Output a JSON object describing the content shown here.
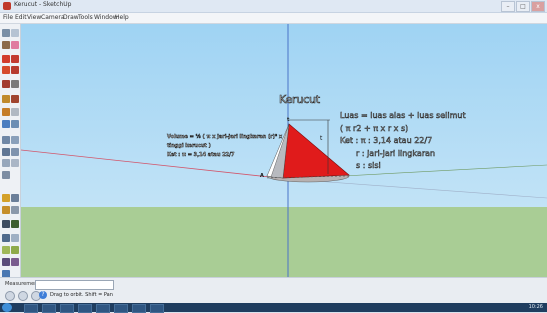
{
  "window": {
    "title": "Kerucut - SketchUp",
    "controls": [
      "–",
      "□",
      "x"
    ]
  },
  "menu": [
    "File",
    "Edit",
    "View",
    "Camera",
    "Draw",
    "Tools",
    "Window",
    "Help"
  ],
  "model": {
    "title": "Kerucut",
    "right_formula": [
      "Luas = luas alas + luas selimut",
      "( π r2 + π x r x s)",
      "Ket : π : 3,14 atau 22/7",
      "r : jari-jari lingkaran",
      "s : sisi"
    ],
    "left_formula": [
      "Volume = ⅓ ( π x jari-jari lingkaran (r)² x",
      "tinggi kerucut )",
      "Ket : π = 3,14 atau 22/7"
    ],
    "apex_label": "t",
    "dim_label": "t",
    "base_label": "A"
  },
  "status": {
    "measurements_label": "Measurements",
    "measurements_value": "",
    "hint": "Drag to orbit.  Shift = Pan"
  },
  "taskbar": {
    "tray_time": "10:26"
  }
}
